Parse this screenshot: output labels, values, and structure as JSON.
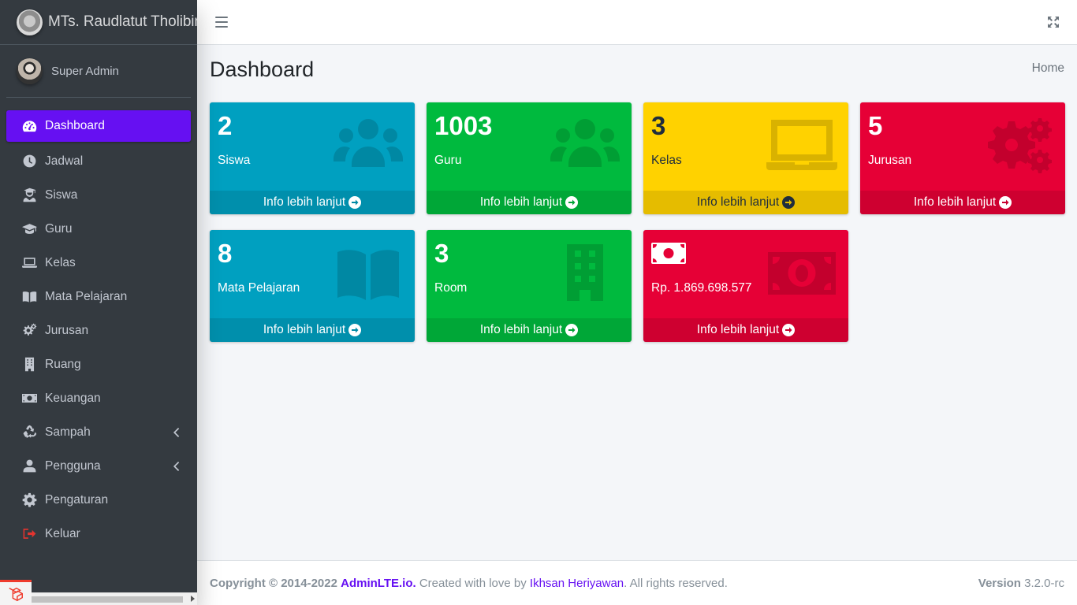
{
  "brand": {
    "title": "MTs. Raudlatut Tholibin"
  },
  "user": {
    "name": "Super Admin"
  },
  "sidebar": {
    "items": [
      {
        "label": "Dashboard",
        "icon": "tachometer-icon",
        "active": true
      },
      {
        "label": "Jadwal",
        "icon": "clock-icon"
      },
      {
        "label": "Siswa",
        "icon": "user-graduate-icon"
      },
      {
        "label": "Guru",
        "icon": "graduation-cap-icon"
      },
      {
        "label": "Kelas",
        "icon": "laptop-icon"
      },
      {
        "label": "Mata Pelajaran",
        "icon": "book-open-icon"
      },
      {
        "label": "Jurusan",
        "icon": "cogs-icon"
      },
      {
        "label": "Ruang",
        "icon": "building-icon"
      },
      {
        "label": "Keuangan",
        "icon": "money-bill-icon"
      },
      {
        "label": "Sampah",
        "icon": "recycle-icon",
        "has_children": true
      },
      {
        "label": "Pengguna",
        "icon": "user-icon",
        "has_children": true
      },
      {
        "label": "Pengaturan",
        "icon": "cog-icon"
      },
      {
        "label": "Keluar",
        "icon": "sign-out-icon"
      }
    ]
  },
  "page": {
    "title": "Dashboard",
    "breadcrumb": "Home"
  },
  "boxes": [
    {
      "value": "2",
      "label": "Siswa",
      "footer": "Info lebih lanjut",
      "color": "#00a0c0",
      "icon": "users-icon"
    },
    {
      "value": "1003",
      "label": "Guru",
      "footer": "Info lebih lanjut",
      "color": "#00ba3e",
      "icon": "users-icon"
    },
    {
      "value": "3",
      "label": "Kelas",
      "footer": "Info lebih lanjut",
      "color": "#ffd200",
      "icon": "laptop-icon"
    },
    {
      "value": "5",
      "label": "Jurusan",
      "footer": "Info lebih lanjut",
      "color": "#e60036",
      "icon": "cogs-icon"
    },
    {
      "value": "8",
      "label": "Mata Pelajaran",
      "footer": "Info lebih lanjut",
      "color": "#00a0c0",
      "icon": "book-open-icon"
    },
    {
      "value": "3",
      "label": "Room",
      "footer": "Info lebih lanjut",
      "color": "#00ba3e",
      "icon": "building-icon"
    },
    {
      "value": "",
      "label": "Rp. 1.869.698.577",
      "footer": "Info lebih lanjut",
      "color": "#e60036",
      "icon": "money-bill-icon"
    }
  ],
  "footer": {
    "copyright": "Copyright © 2014-2022",
    "brand_link": "AdminLTE.io.",
    "created_text": "Created with love by",
    "author_link": "Ikhsan Heriyawan",
    "rights": ". All rights reserved.",
    "version_label": "Version",
    "version_value": "3.2.0-rc"
  },
  "colors": {
    "sidebar_bg": "#343a40",
    "active_item": "#6610f2",
    "content_bg": "#f4f6f9"
  }
}
